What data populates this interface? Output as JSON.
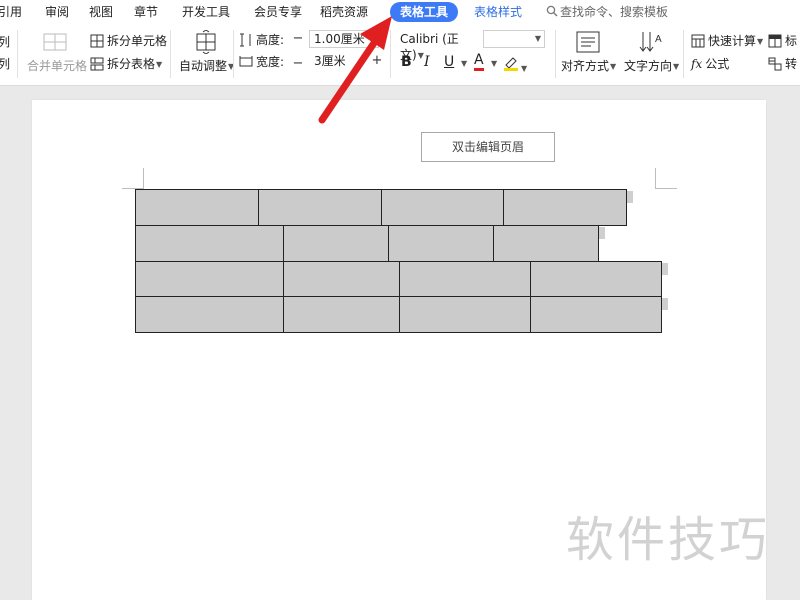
{
  "menu": {
    "items": [
      "引用",
      "审阅",
      "视图",
      "章节",
      "开发工具",
      "会员专享",
      "稻壳资源"
    ],
    "active_tab": "表格工具",
    "style_tab": "表格样式",
    "search_placeholder": "查找命令、搜索模板"
  },
  "ribbon": {
    "col_top": "列",
    "col_bottom": "列",
    "merge_cells": "合并单元格",
    "split_cells": "拆分单元格",
    "split_table": "拆分表格",
    "auto_fit": "自动调整",
    "height_label": "高度:",
    "height_value": "1.00厘米",
    "width_label": "宽度:",
    "width_value": "3厘米",
    "font_name": "Calibri (正文)",
    "bold": "B",
    "italic": "I",
    "underline": "U",
    "font_color": "A",
    "align": "对齐方式",
    "text_direction": "文字方向",
    "quick_calc": "快速计算",
    "formula": "公式",
    "fx": "fx",
    "title_row": "标",
    "convert": "转",
    "minus": "−",
    "plus": "+"
  },
  "document": {
    "header_hint": "双击编辑页眉"
  },
  "colors": {
    "accent": "#3c7bf5",
    "arrow": "#e02020",
    "cell_fill": "#cbcbcb",
    "highlight": "#f5d800"
  },
  "watermark": "软件技巧"
}
